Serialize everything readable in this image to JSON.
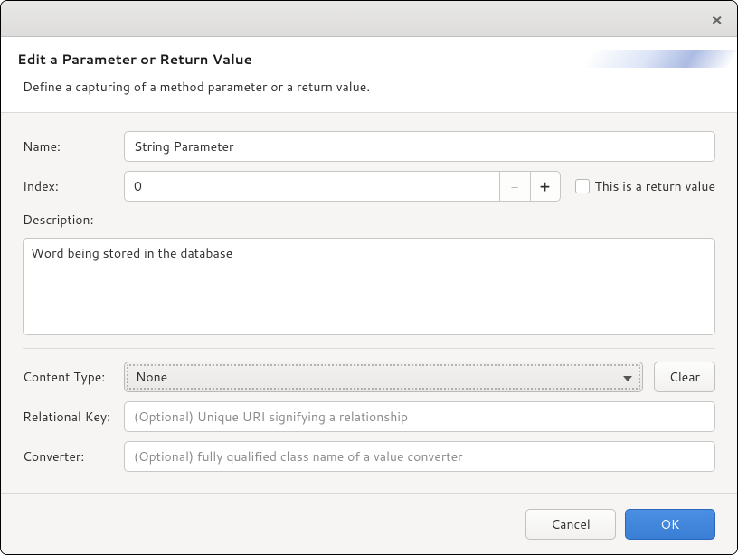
{
  "window": {
    "close_glyph": "×"
  },
  "header": {
    "title": "Edit a Parameter or Return Value",
    "subtitle": "Define a capturing of a method parameter or a return value."
  },
  "form": {
    "name_label": "Name:",
    "name_value": "String Parameter",
    "index_label": "Index:",
    "index_value": "0",
    "return_value_label": "This is a return value",
    "description_label": "Description:",
    "description_value": "Word being stored in the database",
    "content_type_label": "Content Type:",
    "content_type_value": "None",
    "clear_label": "Clear",
    "relational_key_label": "Relational Key:",
    "relational_key_placeholder": "(Optional) Unique URI signifying a relationship",
    "relational_key_value": "",
    "converter_label": "Converter:",
    "converter_placeholder": "(Optional) fully qualified class name of a value converter",
    "converter_value": ""
  },
  "footer": {
    "cancel_label": "Cancel",
    "ok_label": "OK"
  }
}
